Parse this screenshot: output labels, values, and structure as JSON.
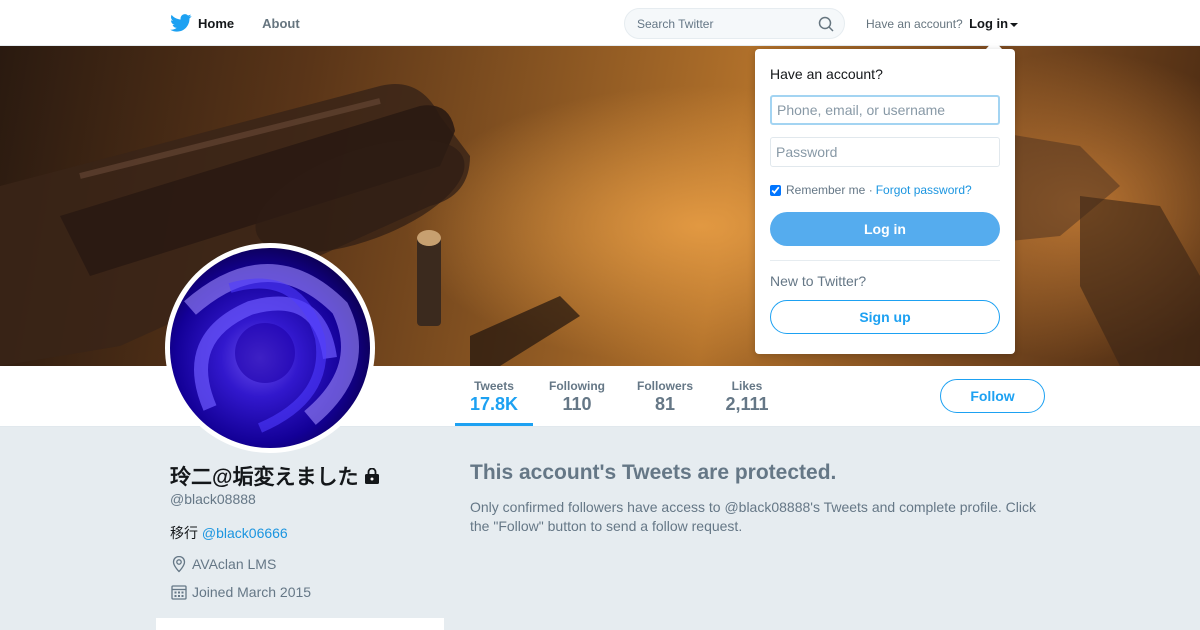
{
  "nav": {
    "home_label": "Home",
    "about_label": "About",
    "search_placeholder": "Search Twitter",
    "have_account": "Have an account?",
    "login_label": "Log in"
  },
  "stats": [
    {
      "label": "Tweets",
      "value": "17.8K"
    },
    {
      "label": "Following",
      "value": "110"
    },
    {
      "label": "Followers",
      "value": "81"
    },
    {
      "label": "Likes",
      "value": "2,111"
    }
  ],
  "follow_label": "Follow",
  "profile": {
    "name": "玲二@垢変えました",
    "handle": "@black08888",
    "bio_prefix": "移行 ",
    "bio_link": "@black06666",
    "location": "AVAclan LMS",
    "joined": "Joined March 2015"
  },
  "protected": {
    "title": "This account's Tweets are protected.",
    "description": "Only confirmed followers have access to @black08888's Tweets and complete profile. Click the \"Follow\" button to send a follow request."
  },
  "login_dropdown": {
    "title": "Have an account?",
    "username_placeholder": "Phone, email, or username",
    "password_placeholder": "Password",
    "remember_label": "Remember me ·",
    "forgot_label": "Forgot password?",
    "login_button": "Log in",
    "new_label": "New to Twitter?",
    "signup_button": "Sign up"
  },
  "colors": {
    "accent": "#1da1f2",
    "login_button": "#55acee"
  }
}
